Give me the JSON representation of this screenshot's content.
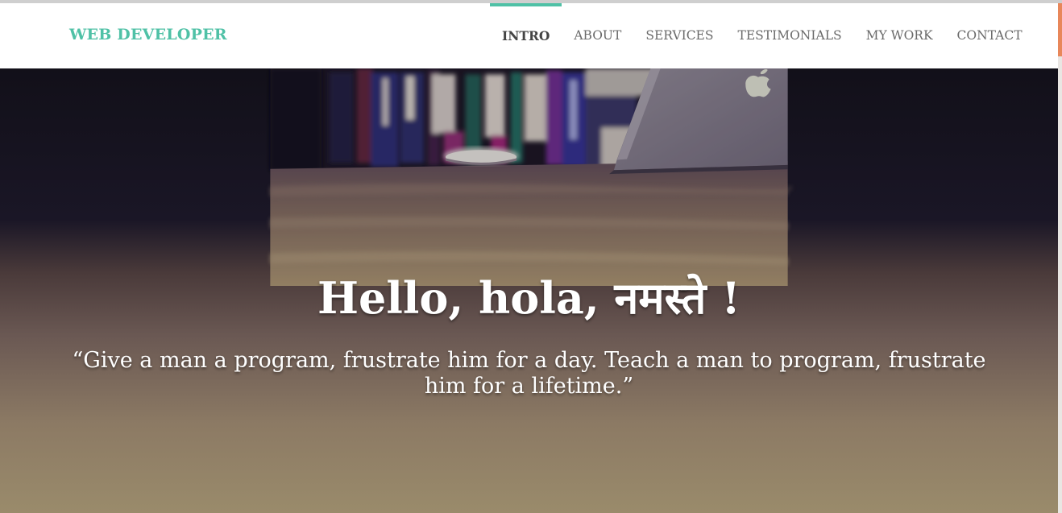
{
  "brand": "WEB DEVELOPER",
  "nav": {
    "items": [
      {
        "label": "INTRO",
        "active": true
      },
      {
        "label": "ABOUT",
        "active": false
      },
      {
        "label": "SERVICES",
        "active": false
      },
      {
        "label": "TESTIMONIALS",
        "active": false
      },
      {
        "label": "MY WORK",
        "active": false
      },
      {
        "label": "CONTACT",
        "active": false
      }
    ]
  },
  "hero": {
    "title": "Hello, hola, नमस्ते !",
    "quote": "“Give a man a program, frustrate him for a day. Teach a man to program, frustrate him for a lifetime.”"
  },
  "colors": {
    "accent": "#4fc1a6",
    "scroll_thumb": "#e8875a",
    "nav_text": "#6a6a6a"
  },
  "icons": {
    "hero_background": "laptop-desk-photo",
    "laptop_logo": "apple-logo"
  }
}
